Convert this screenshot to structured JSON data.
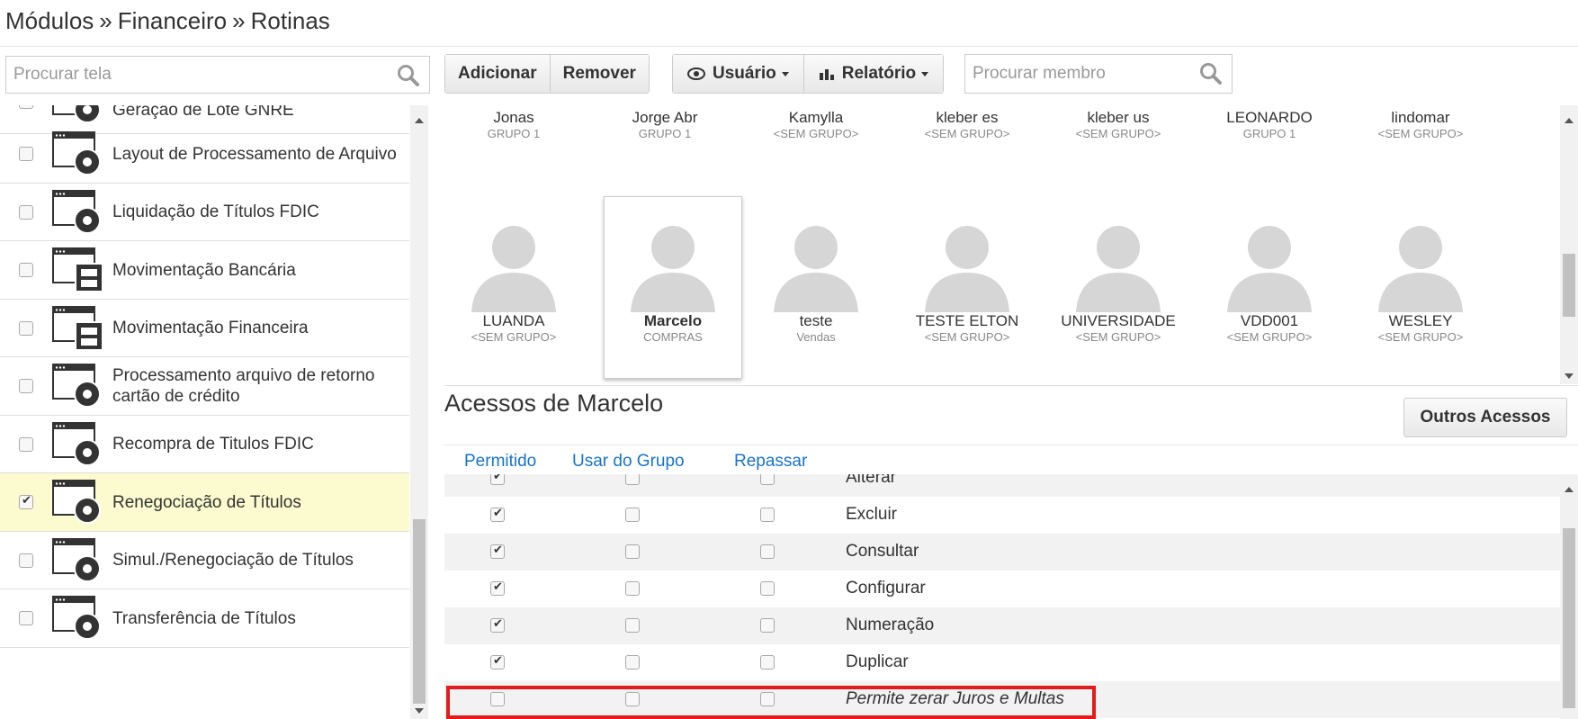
{
  "breadcrumb": {
    "part1": "Módulos",
    "sep1": "»",
    "part2": "Financeiro",
    "sep2": "»",
    "part3": "Rotinas"
  },
  "screen_search": {
    "placeholder": "Procurar tela",
    "icon": "search-icon"
  },
  "toolbar": {
    "add_label": "Adicionar",
    "remove_label": "Remover",
    "user_label": "Usuário",
    "report_label": "Relatório",
    "user_icon": "eye-icon",
    "report_icon": "bar-chart-icon"
  },
  "member_search": {
    "placeholder": "Procurar membro",
    "icon": "search-icon"
  },
  "screens": [
    {
      "label": "Geração de Lote GNRE",
      "checked": false,
      "icon": "gear-window-icon"
    },
    {
      "label": "Layout de Processamento de Arquivo",
      "checked": false,
      "icon": "gear-window-icon"
    },
    {
      "label": "Liquidação de Títulos FDIC",
      "checked": false,
      "icon": "gear-window-icon"
    },
    {
      "label": "Movimentação Bancária",
      "checked": false,
      "icon": "cabinet-window-icon"
    },
    {
      "label": "Movimentação Financeira",
      "checked": false,
      "icon": "cabinet-window-icon"
    },
    {
      "label": "Processamento arquivo de retorno cartão de crédito",
      "checked": false,
      "icon": "gear-window-icon"
    },
    {
      "label": "Recompra de Titulos FDIC",
      "checked": false,
      "icon": "gear-window-icon"
    },
    {
      "label": "Renegociação de Títulos",
      "checked": true,
      "icon": "gear-window-icon",
      "selected": true
    },
    {
      "label": "Simul./Renegociação de Títulos",
      "checked": false,
      "icon": "gear-window-icon"
    },
    {
      "label": "Transferência de Títulos",
      "checked": false,
      "icon": "gear-window-icon"
    }
  ],
  "members_row1": [
    {
      "name": "Jonas",
      "group": "GRUPO 1"
    },
    {
      "name": "Jorge Abr",
      "group": "GRUPO 1"
    },
    {
      "name": "Kamylla",
      "group": "<SEM GRUPO>"
    },
    {
      "name": "kleber es",
      "group": "<SEM GRUPO>"
    },
    {
      "name": "kleber us",
      "group": "<SEM GRUPO>"
    },
    {
      "name": "LEONARDO",
      "group": "GRUPO 1"
    },
    {
      "name": "lindomar",
      "group": "<SEM GRUPO>"
    }
  ],
  "members_row2": [
    {
      "name": "LUANDA",
      "group": "<SEM GRUPO>"
    },
    {
      "name": "Marcelo",
      "group": "COMPRAS",
      "selected": true
    },
    {
      "name": "teste",
      "group": "Vendas"
    },
    {
      "name": "TESTE ELTON",
      "group": "<SEM GRUPO>"
    },
    {
      "name": "UNIVERSIDADE",
      "group": "<SEM GRUPO>"
    },
    {
      "name": "VDD001",
      "group": "<SEM GRUPO>"
    },
    {
      "name": "WESLEY",
      "group": "<SEM GRUPO>"
    }
  ],
  "access": {
    "title": "Acessos de Marcelo",
    "other_button": "Outros Acessos",
    "columns": {
      "allowed": "Permitido",
      "use_group": "Usar do Grupo",
      "pass_on": "Repassar"
    },
    "rows": [
      {
        "label": "Alterar",
        "allowed": true,
        "use_group": false,
        "pass_on": false
      },
      {
        "label": "Excluir",
        "allowed": true,
        "use_group": false,
        "pass_on": false
      },
      {
        "label": "Consultar",
        "allowed": true,
        "use_group": false,
        "pass_on": false
      },
      {
        "label": "Configurar",
        "allowed": true,
        "use_group": false,
        "pass_on": false
      },
      {
        "label": "Numeração",
        "allowed": true,
        "use_group": false,
        "pass_on": false
      },
      {
        "label": "Duplicar",
        "allowed": true,
        "use_group": false,
        "pass_on": false
      },
      {
        "label": "Permite zerar Juros e Multas",
        "allowed": false,
        "use_group": false,
        "pass_on": false,
        "italic": true,
        "highlighted": true
      }
    ]
  },
  "colors": {
    "link": "#1a73c8",
    "selected_row": "#fbfbcf",
    "highlight_border": "#e21c1c"
  }
}
